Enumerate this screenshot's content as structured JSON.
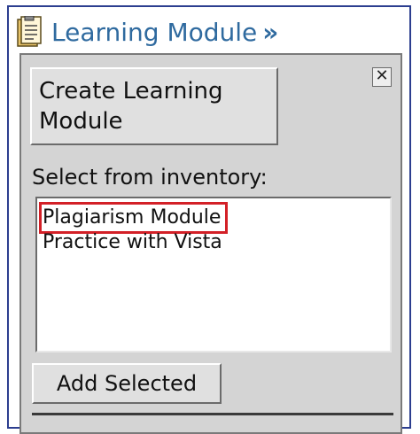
{
  "header": {
    "icon": "document-icon",
    "title": "Learning Module",
    "chevron": "»"
  },
  "panel": {
    "create_button_label": "Create Learning Module",
    "close_label": "✕",
    "inventory_label": "Select from inventory:",
    "inventory_items": [
      {
        "label": "Plagiarism Module",
        "highlighted": true
      },
      {
        "label": "Practice with Vista",
        "highlighted": false
      }
    ],
    "add_button_label": "Add Selected"
  },
  "colors": {
    "header_text": "#2f6a9f",
    "frame_border": "#2c3e8f",
    "panel_bg": "#d4d4d4",
    "highlight": "#d32027"
  }
}
